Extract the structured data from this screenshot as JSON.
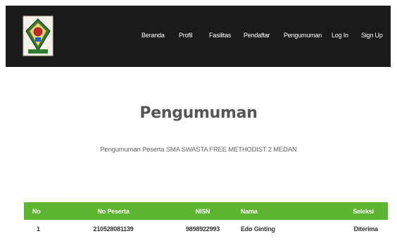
{
  "nav": {
    "items": [
      {
        "label": "Beranda"
      },
      {
        "label": "Profil"
      },
      {
        "label": "Fasilitas"
      },
      {
        "label": "Pendaftar"
      },
      {
        "label": "Pengumuman"
      },
      {
        "label": "Log In"
      },
      {
        "label": "Sign Up"
      }
    ]
  },
  "page": {
    "title": "Pengumuman",
    "subtitle": "Pengumuman Peserta SMA SWASTA FREE METHODIST 2 MEDAN"
  },
  "table": {
    "headers": [
      "No",
      "No Peserta",
      "NISN",
      "Nama",
      "Seleksi"
    ],
    "rows": [
      [
        "1",
        "210528081139",
        "9898922993",
        "Edo Ginting",
        "Diterima"
      ]
    ]
  },
  "colors": {
    "navbar": "#1a1a1a",
    "table_header": "#5cb531"
  }
}
